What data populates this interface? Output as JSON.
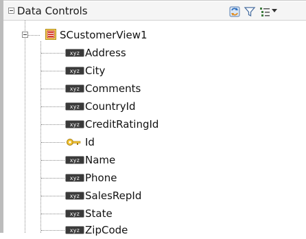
{
  "panel": {
    "title": "Data Controls",
    "toolbar_icons": [
      "refresh-icon",
      "filter-icon",
      "view-options-icon",
      "dropdown-arrow-icon"
    ]
  },
  "tree": {
    "root": {
      "label": "SCustomerView1",
      "icon": "view-object-icon",
      "attributes": [
        {
          "label": "Address",
          "icon": "text-attribute-icon"
        },
        {
          "label": "City",
          "icon": "text-attribute-icon"
        },
        {
          "label": "Comments",
          "icon": "text-attribute-icon"
        },
        {
          "label": "CountryId",
          "icon": "text-attribute-icon"
        },
        {
          "label": "CreditRatingId",
          "icon": "text-attribute-icon"
        },
        {
          "label": "Id",
          "icon": "key-attribute-icon"
        },
        {
          "label": "Name",
          "icon": "text-attribute-icon"
        },
        {
          "label": "Phone",
          "icon": "text-attribute-icon"
        },
        {
          "label": "SalesRepId",
          "icon": "text-attribute-icon"
        },
        {
          "label": "State",
          "icon": "text-attribute-icon"
        },
        {
          "label": "ZipCode",
          "icon": "text-attribute-icon"
        }
      ]
    }
  }
}
